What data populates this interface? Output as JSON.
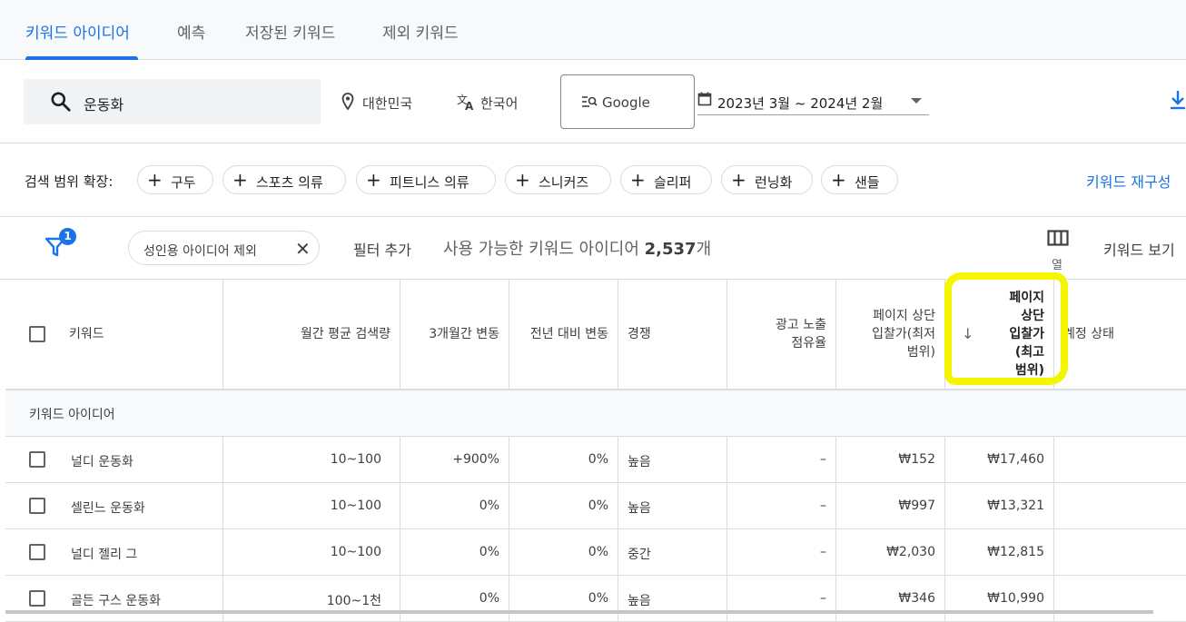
{
  "tabs": [
    "키워드 아이디어",
    "예측",
    "저장된 키워드",
    "제외 키워드"
  ],
  "search": {
    "query": "운동화"
  },
  "location": "대한민국",
  "language": "한국어",
  "network": "Google",
  "date_range": "2023년 3월 ~ 2024년 2월",
  "expand": {
    "label": "검색 범위 확장:",
    "chips": [
      "구두",
      "스포츠 의류",
      "피트니스 의류",
      "스니커즈",
      "슬리퍼",
      "런닝화",
      "샌들"
    ],
    "regen_label": "키워드 재구성"
  },
  "filter": {
    "badge": "1",
    "chip_label": "성인용 아이디어 제외",
    "add_label": "필터 추가",
    "available_prefix": "사용 가능한 키워드 아이디어",
    "available_count": "2,537",
    "available_suffix": "개",
    "columns_label": "열",
    "keyword_view_label": "키워드 보기"
  },
  "table": {
    "headers": {
      "keyword": "키워드",
      "volume": "월간 평균 검색량",
      "change3m": "3개월간 변동",
      "yoy": "전년 대비 변동",
      "competition": "경쟁",
      "impression_line1": "광고 노출",
      "impression_line2": "점유율",
      "low_bid_line1": "페이지 상단",
      "low_bid_line2": "입찰가(최저",
      "low_bid_line3": "범위)",
      "high_bid_line1": "페이지",
      "high_bid_line2": "상단",
      "high_bid_line3": "입찰가",
      "high_bid_line4": "(최고",
      "high_bid_line5": "범위)",
      "sort_arrow": "↓",
      "account_status": "계정 상태"
    },
    "section_label": "키워드 아이디어",
    "rows": [
      {
        "keyword": "널디 운동화",
        "volume": "10~100",
        "change3m": "+900%",
        "yoy": "0%",
        "competition": "높음",
        "impression": "–",
        "low_bid": "₩152",
        "high_bid": "₩17,460"
      },
      {
        "keyword": "셀린느 운동화",
        "volume": "10~100",
        "change3m": "0%",
        "yoy": "0%",
        "competition": "높음",
        "impression": "–",
        "low_bid": "₩997",
        "high_bid": "₩13,321"
      },
      {
        "keyword": "널디 젤리 그",
        "volume": "10~100",
        "change3m": "0%",
        "yoy": "0%",
        "competition": "중간",
        "impression": "–",
        "low_bid": "₩2,030",
        "high_bid": "₩12,815"
      },
      {
        "keyword": "골든 구스 운동화",
        "volume": "100~1천",
        "change3m": "0%",
        "yoy": "0%",
        "competition": "높음",
        "impression": "–",
        "low_bid": "₩346",
        "high_bid": "₩10,990"
      }
    ]
  },
  "colors": {
    "accent": "#1a73e8",
    "highlight": "#f5f500"
  }
}
